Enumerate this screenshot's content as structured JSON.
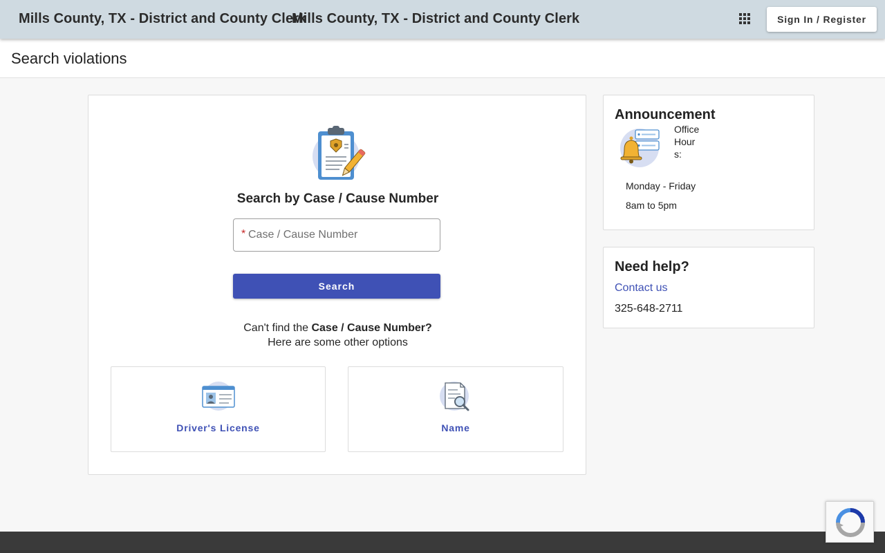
{
  "header": {
    "brand_primary": "Mills County, TX - District and County Clerk",
    "brand_secondary": "Mills County, TX - District and County Clerk",
    "apps_icon": "apps-grid-icon",
    "signin_label": "Sign In / Register"
  },
  "page": {
    "title": "Search violations"
  },
  "search": {
    "icon": "clipboard-badge-icon",
    "title": "Search by Case / Cause Number",
    "required_mark": "*",
    "placeholder": "Case / Cause Number",
    "value": "",
    "button_label": "Search",
    "cant_find_prefix": "Can't find the ",
    "cant_find_bold": "Case / Cause Number?",
    "other_options": "Here are some other options"
  },
  "options": [
    {
      "label": "Driver's License",
      "icon": "id-card-icon"
    },
    {
      "label": "Name",
      "icon": "document-search-icon"
    }
  ],
  "announcement": {
    "title": "Announcement",
    "icon": "bell-notification-icon",
    "hours_label": "Office Hours:",
    "days": "Monday - Friday",
    "time": "8am to 5pm"
  },
  "help": {
    "title": "Need help?",
    "contact_label": "Contact us",
    "phone": "325-648-2711"
  },
  "colors": {
    "header_bg": "#cfdae1",
    "accent": "#3f51b5",
    "footer_bg": "#3a3a3a",
    "required": "#c62828"
  }
}
